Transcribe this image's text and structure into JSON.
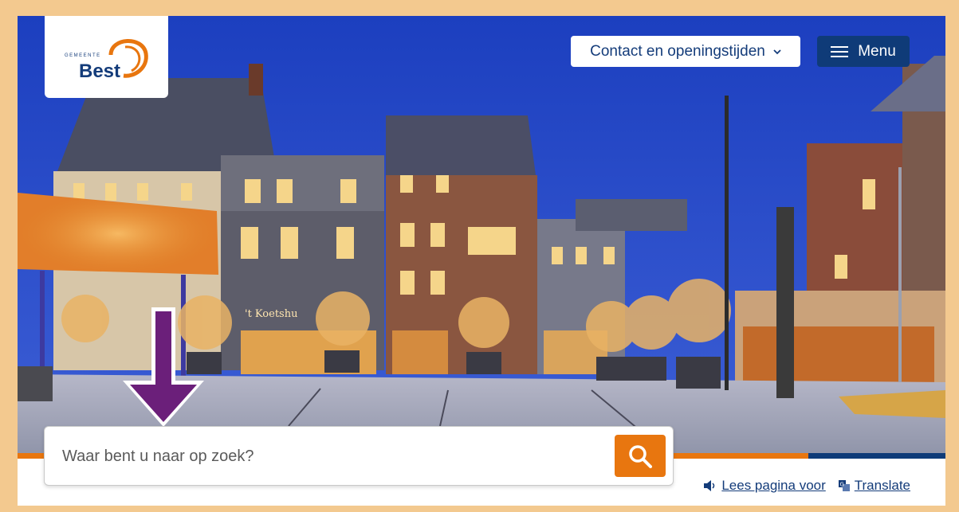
{
  "header": {
    "logo": {
      "prefix": "GEMEENTE",
      "name": "Best"
    },
    "contact_button": {
      "label": "Contact en openingstijden",
      "icon": "chevron-down-icon"
    },
    "menu_button": {
      "label": "Menu",
      "icon": "hamburger-icon"
    }
  },
  "hero": {
    "storefront_sign": "'t Koetshu"
  },
  "search": {
    "placeholder": "Waar bent u naar op zoek?",
    "button_icon": "search-icon"
  },
  "tools": {
    "read_aloud": {
      "label": "Lees pagina voor",
      "icon": "speaker-icon"
    },
    "translate": {
      "label": "Translate",
      "icon": "translate-icon"
    }
  },
  "colors": {
    "brand_blue": "#0f3b78",
    "brand_orange": "#e8760f",
    "border": "#f3c98f"
  }
}
